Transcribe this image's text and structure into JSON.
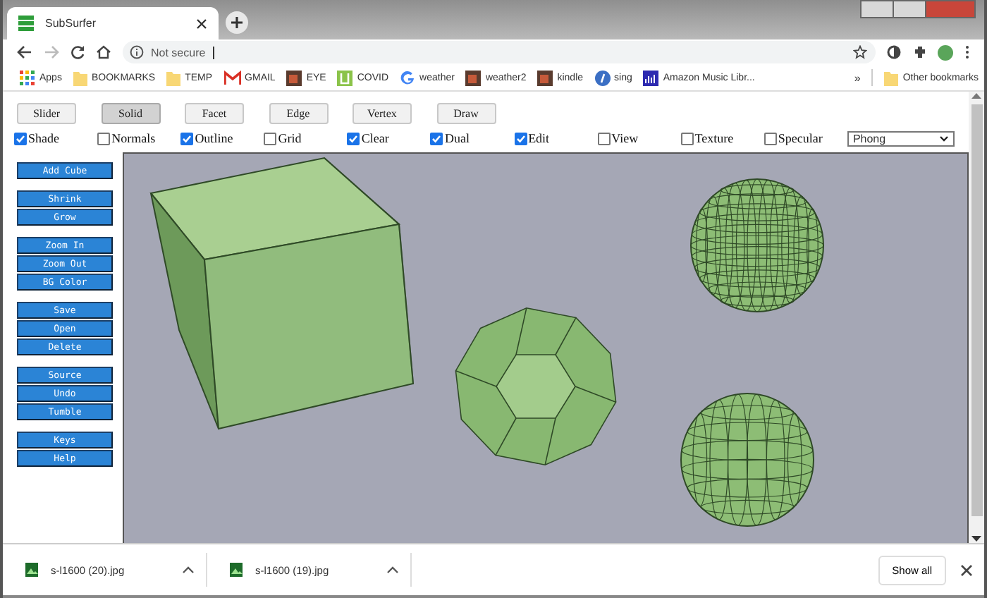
{
  "browser": {
    "tab_title": "SubSurfer",
    "address": "Not secure",
    "bookmarks": [
      {
        "label": "Apps",
        "kind": "grid"
      },
      {
        "label": "BOOKMARKS",
        "kind": "folder"
      },
      {
        "label": "TEMP",
        "kind": "folder"
      },
      {
        "label": "GMAIL",
        "kind": "mail"
      },
      {
        "label": "EYE",
        "kind": "thumb"
      },
      {
        "label": "COVID",
        "kind": "tile"
      },
      {
        "label": "weather",
        "kind": "google"
      },
      {
        "label": "weather2",
        "kind": "thumb"
      },
      {
        "label": "kindle",
        "kind": "thumb"
      },
      {
        "label": "sing",
        "kind": "round"
      },
      {
        "label": "Amazon Music Libr...",
        "kind": "chart"
      }
    ],
    "overflow": "»",
    "other_bookmarks": "Other bookmarks"
  },
  "modes": [
    {
      "label": "Slider",
      "selected": false
    },
    {
      "label": "Solid",
      "selected": true
    },
    {
      "label": "Facet",
      "selected": false
    },
    {
      "label": "Edge",
      "selected": false
    },
    {
      "label": "Vertex",
      "selected": false
    },
    {
      "label": "Draw",
      "selected": false
    }
  ],
  "options": [
    {
      "label": "Shade",
      "checked": true
    },
    {
      "label": "Normals",
      "checked": false
    },
    {
      "label": "Outline",
      "checked": true
    },
    {
      "label": "Grid",
      "checked": false
    },
    {
      "label": "Clear",
      "checked": true
    },
    {
      "label": "Dual",
      "checked": true
    },
    {
      "label": "Edit",
      "checked": true
    },
    {
      "label": "View",
      "checked": false
    },
    {
      "label": "Texture",
      "checked": false
    },
    {
      "label": "Specular",
      "checked": false
    }
  ],
  "shading": {
    "value": "Phong"
  },
  "tool_groups": [
    [
      "Add Cube"
    ],
    [
      "Shrink",
      "Grow"
    ],
    [
      "Zoom In",
      "Zoom Out",
      "BG Color"
    ],
    [
      "Save",
      "Open",
      "Delete"
    ],
    [
      "Source",
      "Undo",
      "Tumble"
    ],
    [
      "Keys",
      "Help"
    ]
  ],
  "downloads": [
    {
      "file": "s-l1600 (20).jpg"
    },
    {
      "file": "s-l1600 (19).jpg"
    }
  ],
  "show_all": "Show all"
}
